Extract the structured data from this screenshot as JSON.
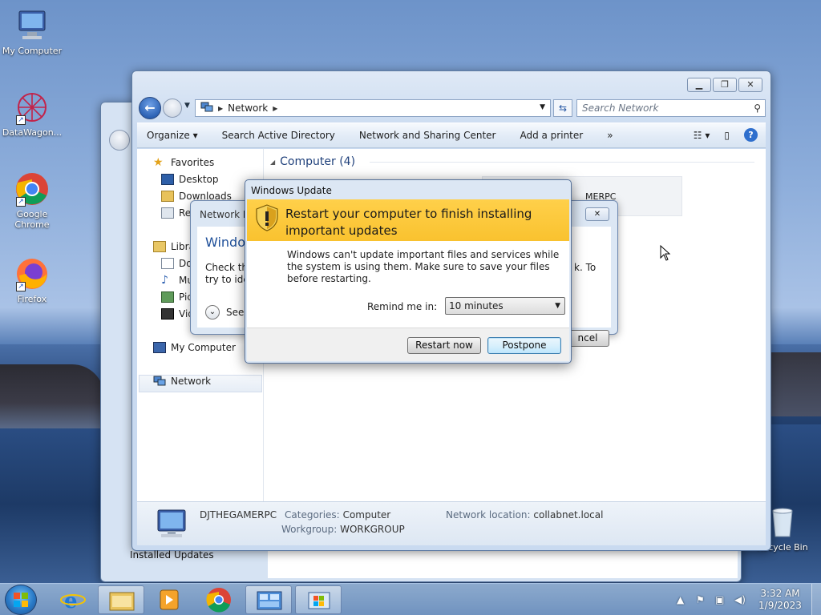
{
  "desktop": {
    "icons": [
      {
        "label": "My Computer"
      },
      {
        "label": "DataWagon..."
      },
      {
        "label": "Google Chrome"
      },
      {
        "label": "Firefox"
      },
      {
        "label": "Recycle Bin"
      }
    ]
  },
  "explorer": {
    "address": {
      "location": "Network"
    },
    "search_placeholder": "Search Network",
    "toolbar": {
      "organize": "Organize",
      "search_ad": "Search Active Directory",
      "network_sharing": "Network and Sharing Center",
      "add_printer": "Add a printer",
      "more": "»"
    },
    "nav": {
      "favorites": "Favorites",
      "desktop": "Desktop",
      "downloads": "Downloads",
      "recent": "Rec",
      "libraries": "Libra",
      "documents": "Do",
      "music": "Mu",
      "pictures": "Pic",
      "videos": "Vid",
      "my_computer": "My Computer",
      "network": "Network"
    },
    "group_title": "Computer (4)",
    "computer_tile": "MERPC",
    "details": {
      "name": "DJTHEGAMERPC",
      "categories_label": "Categories:",
      "categories_value": "Computer",
      "workgroup_label": "Workgroup:",
      "workgroup_value": "WORKGROUP",
      "location_label": "Network location:",
      "location_value": "collabnet.local"
    }
  },
  "network_error": {
    "title": "Network Er",
    "heading": "Window",
    "text_left": "Check the",
    "text_left2": "try to ider",
    "text_right": "k. To",
    "see_more": "See",
    "cancel": "ncel"
  },
  "windows_update": {
    "title": "Windows Update",
    "banner": "Restart your computer to finish installing important updates",
    "message": "Windows can't update important files and services while the system is using them. Make sure to save your files before restarting.",
    "remind_label": "Remind me in:",
    "remind_value": "10 minutes",
    "restart_button": "Restart now",
    "postpone_button": "Postpone"
  },
  "stray_label": "Installed Updates",
  "taskbar": {
    "time": "3:32 AM",
    "date": "1/9/2023"
  }
}
